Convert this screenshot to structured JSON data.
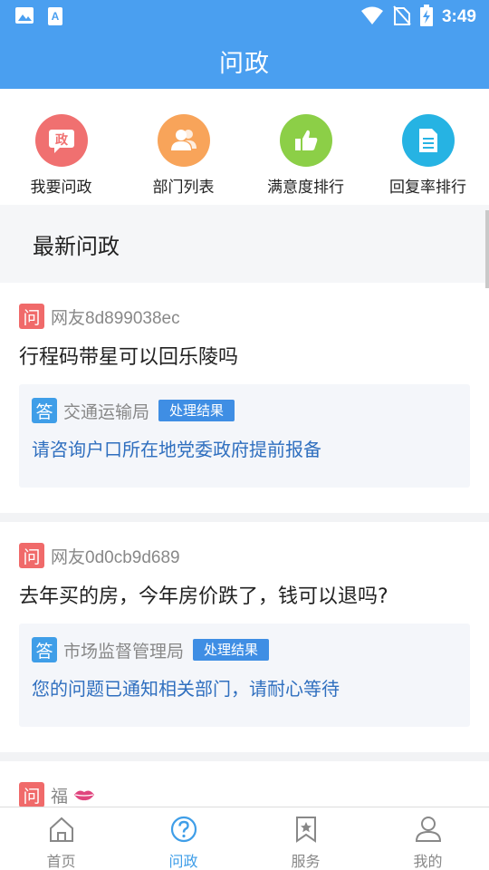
{
  "status_bar": {
    "time": "3:49",
    "left_icons": [
      "image-icon",
      "app-notification-icon"
    ],
    "right_icons": [
      "wifi-icon",
      "no-sim-icon",
      "battery-charging-icon"
    ]
  },
  "app_bar": {
    "title": "问政"
  },
  "quick_nav": [
    {
      "label": "我要问政",
      "icon": "ask-politics-icon",
      "color": "#f07070"
    },
    {
      "label": "部门列表",
      "icon": "department-people-icon",
      "color": "#f8a45a"
    },
    {
      "label": "满意度排行",
      "icon": "thumbs-up-icon",
      "color": "#8ccf47"
    },
    {
      "label": "回复率排行",
      "icon": "document-icon",
      "color": "#26b3e3"
    }
  ],
  "section": {
    "title": "最新问政"
  },
  "feed": [
    {
      "badge": "问",
      "user": "网友8d899038ec",
      "question": "行程码带星可以回乐陵吗",
      "answer_badge": "答",
      "department": "交通运输局",
      "tag": "处理结果",
      "answer": "请咨询户口所在地党委政府提前报备"
    },
    {
      "badge": "问",
      "user": "网友0d0cb9d689",
      "question": "去年买的房，今年房价跌了，钱可以退吗?",
      "answer_badge": "答",
      "department": "市场监督管理局",
      "tag": "处理结果",
      "answer": "您的问题已通知相关部门，请耐心等待"
    },
    {
      "badge": "问",
      "user": "福",
      "user_icon": "lips-emoji-icon"
    }
  ],
  "bottom_nav": [
    {
      "label": "首页",
      "icon": "home-icon",
      "active": false
    },
    {
      "label": "问政",
      "icon": "question-circle-icon",
      "active": true
    },
    {
      "label": "服务",
      "icon": "bookmark-star-icon",
      "active": false
    },
    {
      "label": "我的",
      "icon": "user-icon",
      "active": false
    }
  ],
  "colors": {
    "primary": "#4a9ff0",
    "question_badge": "#f06a6a",
    "answer_badge": "#3f9ee8",
    "answer_text": "#2f6fbf",
    "active_tab": "#3f9ee8"
  }
}
